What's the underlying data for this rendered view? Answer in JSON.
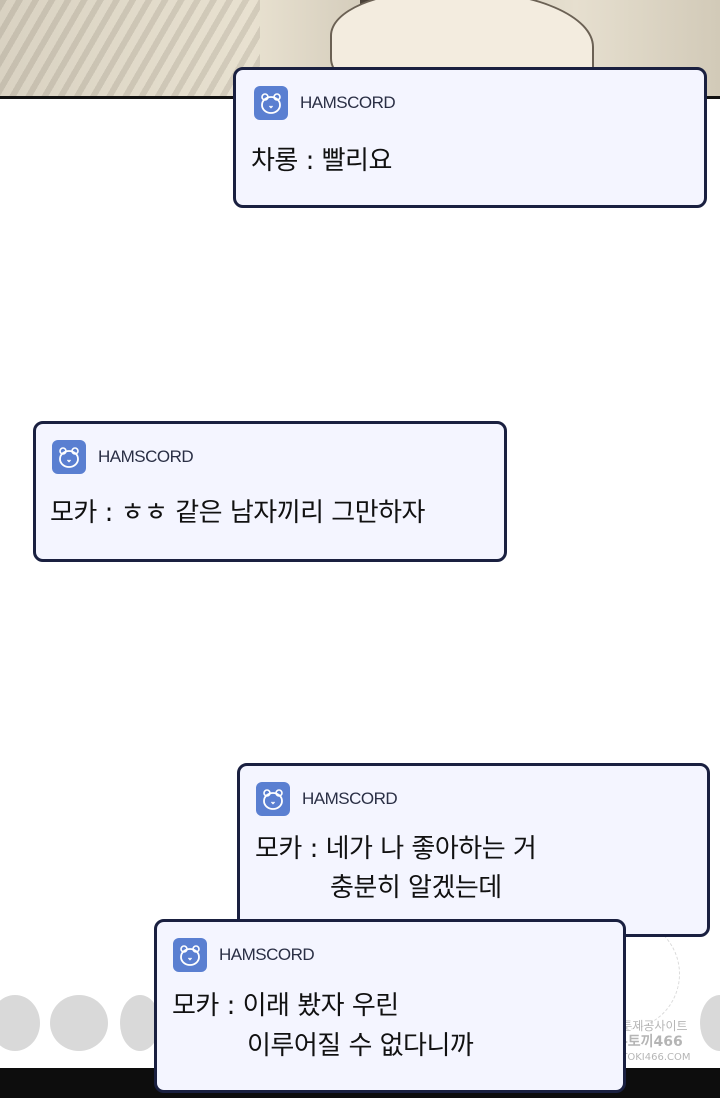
{
  "app": {
    "name": "HAMSCORD",
    "icon": "hamster-icon",
    "accent": "#5a7fd1"
  },
  "messages": [
    {
      "sender": "차롱",
      "separator": ":",
      "lines": [
        "빨리요"
      ]
    },
    {
      "sender": "모카",
      "separator": ":",
      "lines": [
        "ㅎㅎ 같은 남자끼리 그만하자"
      ]
    },
    {
      "sender": "모카",
      "separator": ":",
      "lines": [
        "네가 나 좋아하는 거",
        "충분히 알겠는데"
      ]
    },
    {
      "sender": "모카",
      "separator": ":",
      "lines": [
        "이래 봤자 우린",
        "이루어질 수 없다니까"
      ]
    }
  ],
  "watermark": {
    "line1": "가장 빠른 웹툰제공사이트",
    "line2": "웹툰왕국뉴토끼466",
    "line3": "HTTPS://NEWTOKI466.COM"
  }
}
